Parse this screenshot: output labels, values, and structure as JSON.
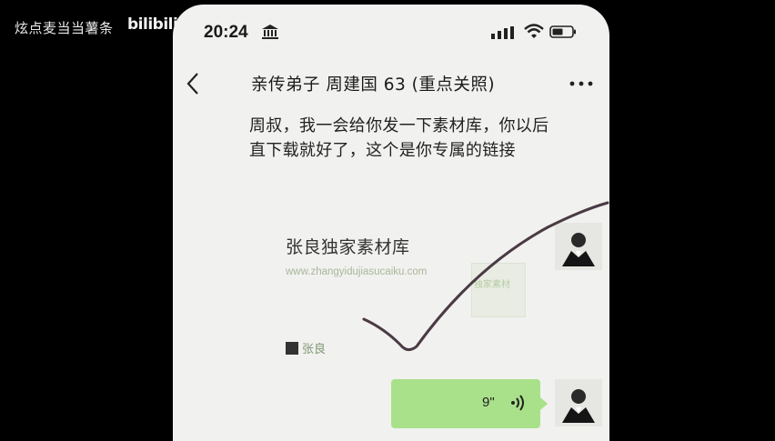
{
  "watermark": {
    "text": "炫点麦当当薯条",
    "logo": "bilibili"
  },
  "status_bar": {
    "time": "20:24"
  },
  "chat": {
    "title": "亲传弟子 周建国 63 (重点关照)"
  },
  "messages": {
    "text_message": "周叔，我一会给你发一下素材库，你以后直下载就好了，这个是你专属的链接",
    "link_card": {
      "title": "张良独家素材库",
      "url": "www.zhangyidujiasucaiku.com",
      "thumb_text": "独家素材",
      "source": "张良"
    },
    "voice_message": {
      "duration": "9\""
    }
  },
  "icons": [
    "bank-icon",
    "signal-icon",
    "wifi-icon",
    "battery-icon",
    "back-icon",
    "more-icon",
    "voice-wave-icon"
  ],
  "colors": {
    "voice_bubble": "#a9e18b",
    "card_url": "#aab79a",
    "annotation_stroke": "#4a3a44"
  }
}
